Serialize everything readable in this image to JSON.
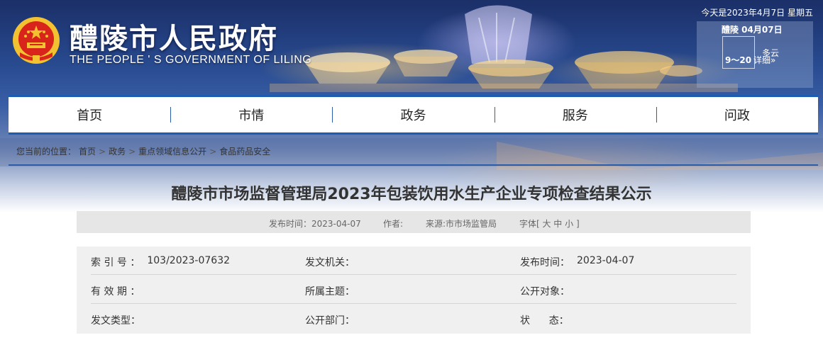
{
  "header": {
    "title": "醴陵市人民政府",
    "subtitle": "THE PEOPLE ' S GOVERNMENT OF LILING",
    "date_line": "今天是2023年4月7日 星期五",
    "emblem_icon": "national-emblem-icon",
    "weather": {
      "city_date": "醴陵 04月07日",
      "temperature": "9～20",
      "condition": "多云",
      "detail": "详细»"
    }
  },
  "nav": {
    "items": [
      "首页",
      "市情",
      "政务",
      "服务",
      "问政"
    ]
  },
  "breadcrumb": {
    "prefix": "您当前的位置：",
    "items": [
      "首页",
      "政务",
      "重点领域信息公开",
      "食品药品安全"
    ],
    "separator": ">"
  },
  "article": {
    "title": "醴陵市市场监督管理局2023年包装饮用水生产企业专项检查结果公示",
    "meta": {
      "publish_time": "发布时间：2023-04-07",
      "author": "作者:",
      "source": "来源:市市场监管局",
      "font_size": "字体[ 大 中 小 ]"
    }
  },
  "info_table": {
    "rows": [
      [
        {
          "label": "索 引 号 ：",
          "value": "103/2023-07632"
        },
        {
          "label": "发文机关：",
          "value": ""
        },
        {
          "label": "发布时间：",
          "value": "2023-04-07"
        }
      ],
      [
        {
          "label": "有 效 期 ：",
          "value": ""
        },
        {
          "label": "所属主题：",
          "value": ""
        },
        {
          "label": "公开对象：",
          "value": ""
        }
      ],
      [
        {
          "label": "发文类型：",
          "value": ""
        },
        {
          "label": "公开部门：",
          "value": ""
        },
        {
          "label": "状      态：",
          "value": ""
        }
      ]
    ]
  },
  "colors": {
    "accent_blue": "#1d5db1",
    "emblem_red": "#d8241a",
    "emblem_gold": "#f2c230"
  }
}
